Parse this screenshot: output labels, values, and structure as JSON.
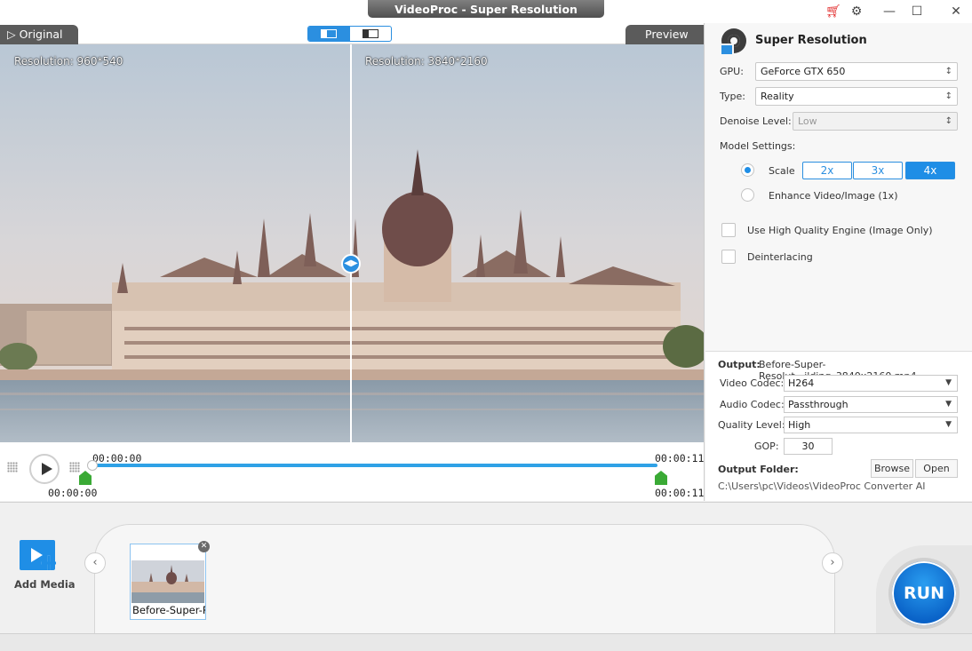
{
  "window": {
    "title": "VideoProc -  Super Resolution"
  },
  "preview": {
    "tab_original": "Original",
    "tab_preview": "Preview",
    "left_resolution": "Resolution: 960*540",
    "right_resolution": "Resolution: 3840*2160",
    "time_start_top": "00:00:00",
    "time_end_top": "00:00:11",
    "time_start_bottom": "00:00:00",
    "time_end_bottom": "00:00:11"
  },
  "panel": {
    "title": "Super Resolution",
    "gpu_label": "GPU:",
    "gpu_value": "GeForce GTX 650",
    "type_label": "Type:",
    "type_value": "Reality",
    "denoise_label": "Denoise Level:",
    "denoise_value": "Low",
    "model_settings_label": "Model Settings:",
    "scale_label": "Scale",
    "scale_options": [
      "2x",
      "3x",
      "4x"
    ],
    "scale_selected": "4x",
    "enhance_label": "Enhance Video/Image (1x)",
    "hq_engine_label": "Use High Quality Engine (Image Only)",
    "deinterlacing_label": "Deinterlacing"
  },
  "output": {
    "output_label": "Output:",
    "output_value": "Before-Super-Resolut...ilding_3840x2160.mp4",
    "video_codec_label": "Video Codec:",
    "video_codec_value": "H264",
    "audio_codec_label": "Audio Codec:",
    "audio_codec_value": "Passthrough",
    "quality_label": "Quality Level:",
    "quality_value": "High",
    "gop_label": "GOP:",
    "gop_value": "30",
    "folder_label": "Output Folder:",
    "browse_label": "Browse",
    "open_label": "Open",
    "folder_path": "C:\\Users\\pc\\Videos\\VideoProc Converter AI"
  },
  "tray": {
    "add_media_label": "Add Media",
    "thumb_label": "Before-Super-Re",
    "run_label": "RUN"
  },
  "colors": {
    "accent": "#1f8ee6",
    "cart": "#e02020",
    "marker": "#3aaa35"
  }
}
